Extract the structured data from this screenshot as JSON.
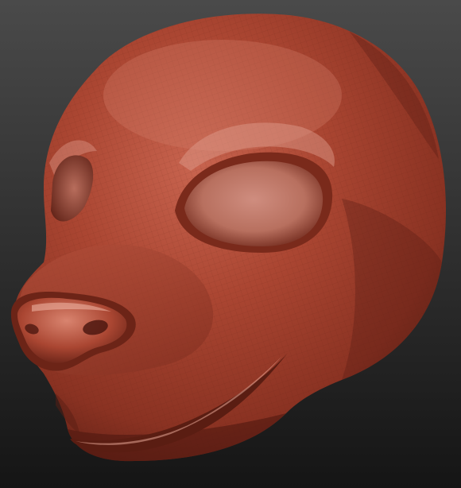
{
  "viewport": {
    "background_top": "#4a4a4a",
    "background_bottom": "#151515"
  },
  "model": {
    "type": "sculpted animal head mask with wireframe polygroups",
    "material_base": "#a8432f",
    "material_highlight": "#d88a78",
    "material_shadow": "#4e1a12",
    "wire_color": "#5a2014"
  }
}
